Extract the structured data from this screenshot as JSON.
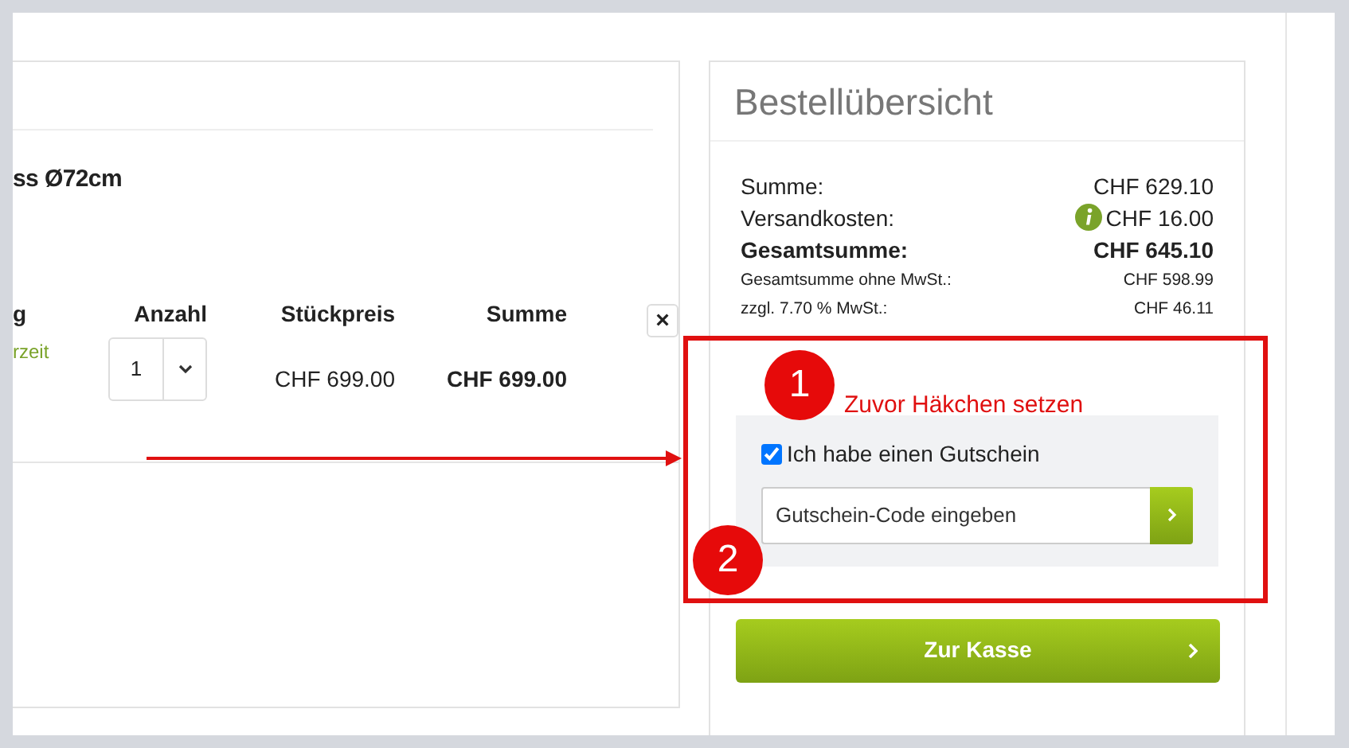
{
  "cart": {
    "title_fragment": "ss Ø72cm",
    "columns": [
      "g",
      "Anzahl",
      "Stückpreis",
      "Summe"
    ],
    "item": {
      "availability_fragment": "rzeit",
      "quantity": "1",
      "unit_price": "CHF 699.00",
      "total": "CHF 699.00",
      "remove": "×"
    }
  },
  "summary": {
    "title": "Bestellübersicht",
    "rows": [
      {
        "kind": "normal",
        "label": "Summe:",
        "value": "CHF 629.10"
      },
      {
        "kind": "info",
        "label": "Versandkosten:",
        "value": "CHF 16.00"
      },
      {
        "kind": "total",
        "label": "Gesamtsumme:",
        "value": "CHF 645.10"
      },
      {
        "kind": "net",
        "label": "Gesamtsumme ohne MwSt.:",
        "value": "CHF 598.99"
      },
      {
        "kind": "net",
        "label": "zzgl. 7.70 % MwSt.:",
        "value": "CHF 46.11"
      }
    ],
    "coupon": {
      "label": "Ich habe einen Gutschein",
      "checked": true,
      "placeholder": "Gutschein-Code eingeben"
    },
    "checkout": {
      "label": "Zur Kasse"
    }
  },
  "annotations": [
    {
      "number": "1",
      "note": "Zuvor Häkchen setzen"
    },
    {
      "number": "2"
    }
  ]
}
